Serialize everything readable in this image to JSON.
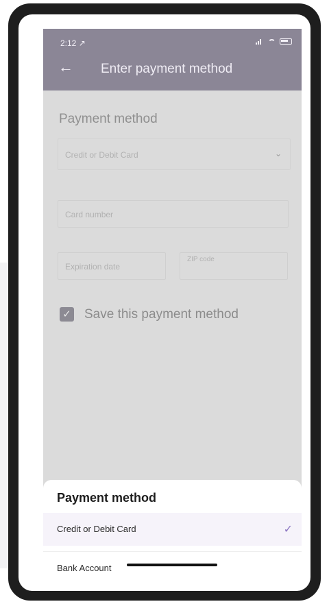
{
  "status_bar": {
    "time": "2:12 ↗"
  },
  "header": {
    "title": "Enter payment method",
    "back_icon": "arrow-left-icon"
  },
  "form": {
    "section_title": "Payment method",
    "method_value": "Credit or Debit Card",
    "card_number_placeholder": "Card number",
    "expiration_placeholder": "Expiration date",
    "zip_label": "ZIP code",
    "save_label": "Save this payment method",
    "save_checked": true
  },
  "sheet": {
    "title": "Payment method",
    "options": [
      {
        "label": "Credit or Debit Card",
        "selected": true
      },
      {
        "label": "Bank Account",
        "selected": false
      }
    ]
  },
  "colors": {
    "header_bg": "#8b8696",
    "accent_check": "#8d77c2",
    "overlay_bg": "#dbdbdb",
    "selected_bg": "#f6f3fa"
  }
}
